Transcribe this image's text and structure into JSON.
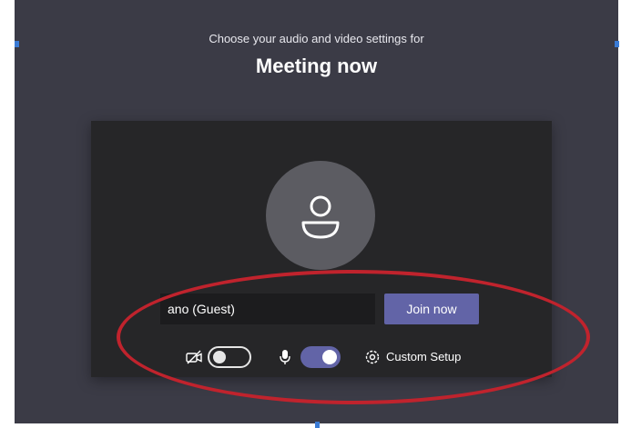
{
  "header": {
    "subtitle": "Choose your audio and video settings for",
    "title": "Meeting now"
  },
  "join": {
    "name_value": "ano (Guest)",
    "join_button": "Join now"
  },
  "controls": {
    "camera_icon": "camera-off-icon",
    "camera_toggle_on": false,
    "mic_icon": "microphone-icon",
    "mic_toggle_on": true,
    "settings_icon": "gear-icon",
    "custom_setup_label": "Custom Setup"
  },
  "colors": {
    "background": "#3b3b46",
    "preview": "#262628",
    "accent": "#6264a7",
    "annotation": "#c0232d"
  }
}
